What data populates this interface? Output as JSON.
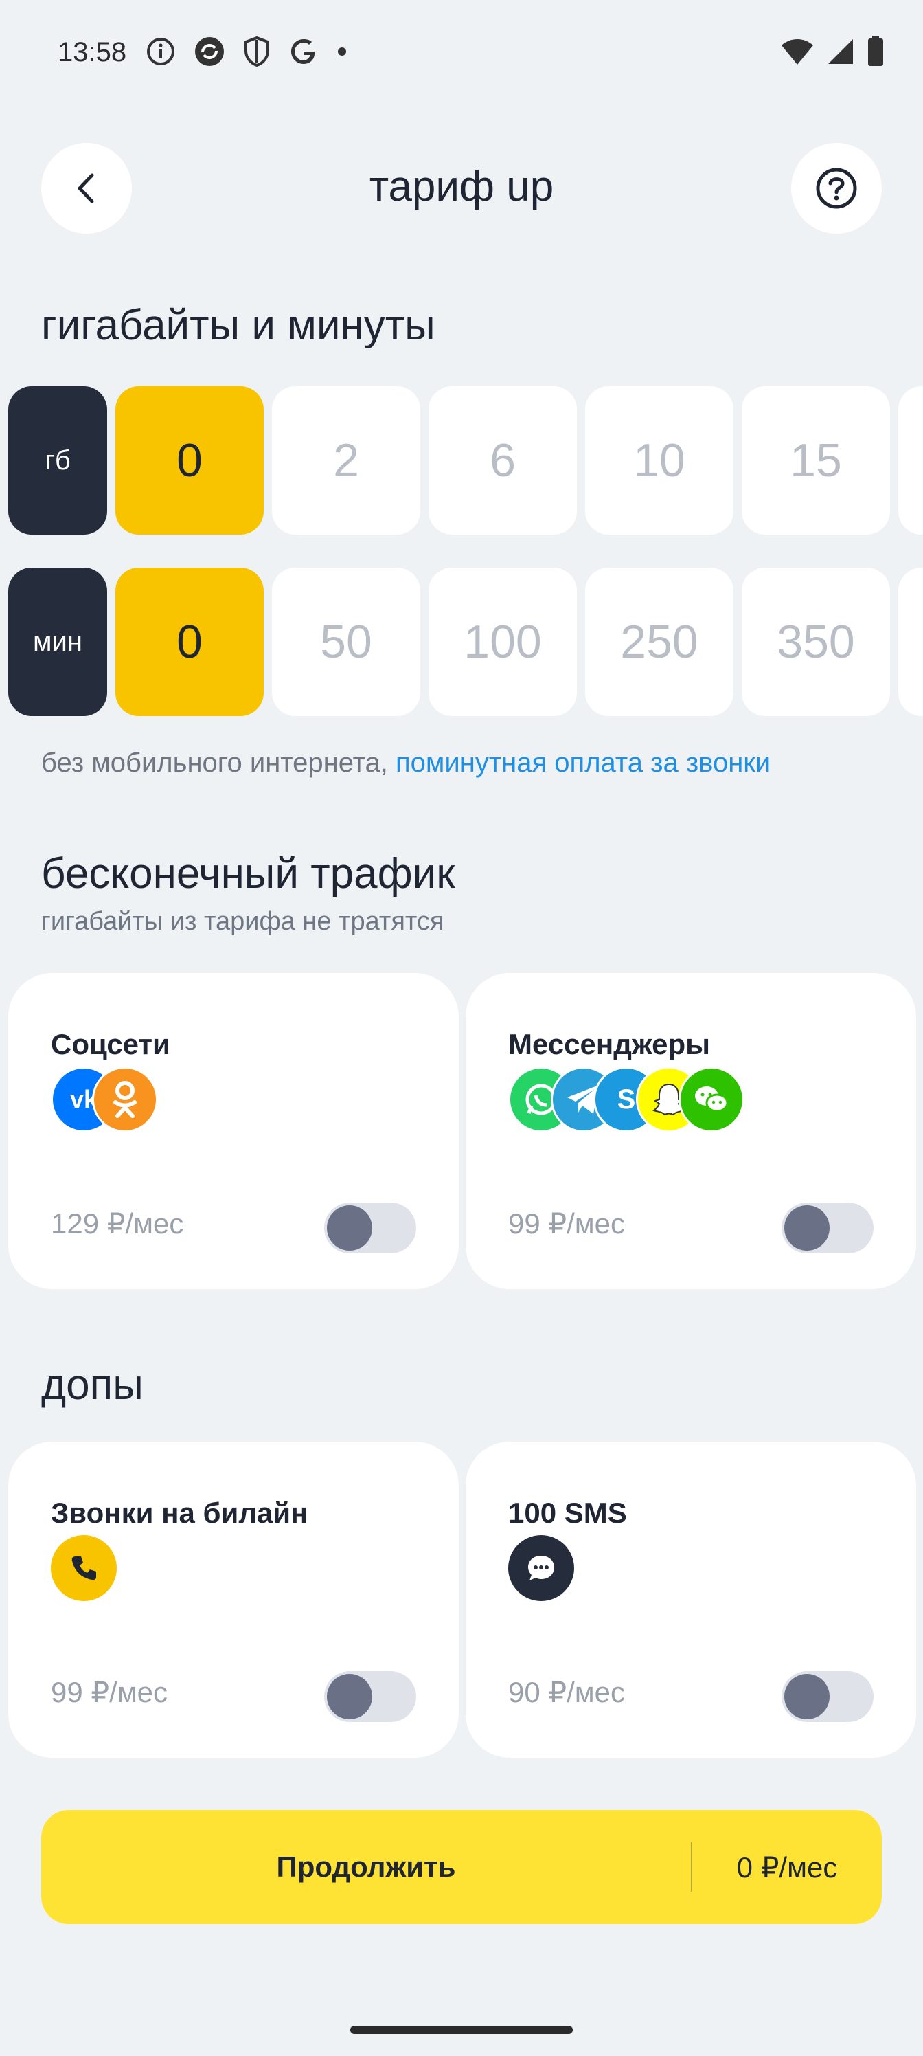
{
  "status_bar": {
    "time": "13:58"
  },
  "header": {
    "title": "тариф up"
  },
  "gb_minutes": {
    "title": "гигабайты и минуты",
    "gb": {
      "label": "гб",
      "options": [
        "0",
        "2",
        "6",
        "10",
        "15"
      ],
      "selected": "0"
    },
    "min": {
      "label": "мин",
      "options": [
        "0",
        "50",
        "100",
        "250",
        "350"
      ],
      "selected": "0"
    },
    "note_text": "без мобильного интернета, ",
    "note_link": "поминутная оплата за звонки"
  },
  "unlimited": {
    "title": "бесконечный трафик",
    "subtitle": "гигабайты из тарифа не тратятся",
    "cards": [
      {
        "title": "Соцсети",
        "price": "129 ₽/мес",
        "enabled": false,
        "icons": [
          "vk-icon",
          "odnoklassniki-icon"
        ]
      },
      {
        "title": "Мессенджеры",
        "price": "99 ₽/мес",
        "enabled": false,
        "icons": [
          "whatsapp-icon",
          "telegram-icon",
          "skype-icon",
          "snapchat-icon",
          "wechat-icon"
        ]
      }
    ]
  },
  "addons": {
    "title": "допы",
    "cards": [
      {
        "title": "Звонки на билайн",
        "price": "99 ₽/мес",
        "enabled": false,
        "icons": [
          "phone-icon"
        ]
      },
      {
        "title": "100 SMS",
        "price": "90 ₽/мес",
        "enabled": false,
        "icons": [
          "message-icon"
        ]
      }
    ]
  },
  "cta": {
    "label": "Продолжить",
    "price": "0 ₽/мес"
  },
  "colors": {
    "accent_yellow": "#f8c400",
    "button_yellow": "#ffe334",
    "dark": "#252c3b",
    "link": "#1f8fe3"
  }
}
